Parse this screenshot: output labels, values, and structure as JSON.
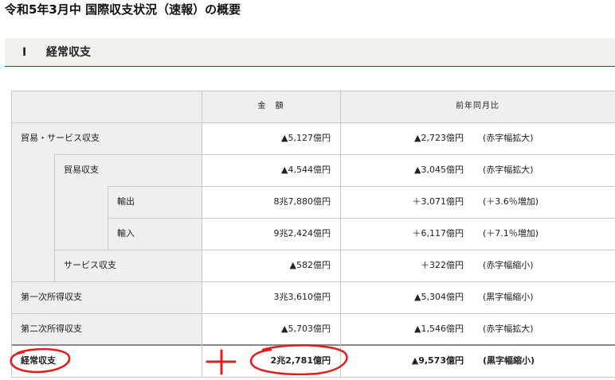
{
  "page": {
    "title": "令和5年3月中 国際収支状況（速報）の概要"
  },
  "section": {
    "number": "Ⅰ",
    "title": "経常収支"
  },
  "table": {
    "headers": {
      "amount": "金　額",
      "yoy": "前年同月比"
    },
    "rows": [
      {
        "label": "貿易・サービス収支",
        "amount": "▲5,127億円",
        "yoy": "▲2,723億円",
        "note": "(赤字幅拡大)"
      },
      {
        "label": "貿易収支",
        "amount": "▲4,544億円",
        "yoy": "▲3,045億円",
        "note": "(赤字幅拡大)"
      },
      {
        "label": "輸出",
        "amount": "8兆7,880億円",
        "yoy": "＋3,071億円",
        "note": "(＋3.6％増加)"
      },
      {
        "label": "輸入",
        "amount": "9兆2,424億円",
        "yoy": "＋6,117億円",
        "note": "(＋7.1％増加)"
      },
      {
        "label": "サービス収支",
        "amount": "▲582億円",
        "yoy": "＋322億円",
        "note": "(赤字幅縮小)"
      },
      {
        "label": "第一次所得収支",
        "amount": "3兆3,610億円",
        "yoy": "▲5,304億円",
        "note": "(黒字幅縮小)"
      },
      {
        "label": "第二次所得収支",
        "amount": "▲5,703億円",
        "yoy": "▲1,546億円",
        "note": "(赤字幅拡大)"
      },
      {
        "label": "経常収支",
        "amount": "2兆2,781億円",
        "yoy": "▲9,573億円",
        "note": "(黒字幅縮小)"
      }
    ]
  },
  "colors": {
    "accent": "#9b1d20",
    "annotation": "#e21b1b",
    "header_bg": "#efefef"
  }
}
